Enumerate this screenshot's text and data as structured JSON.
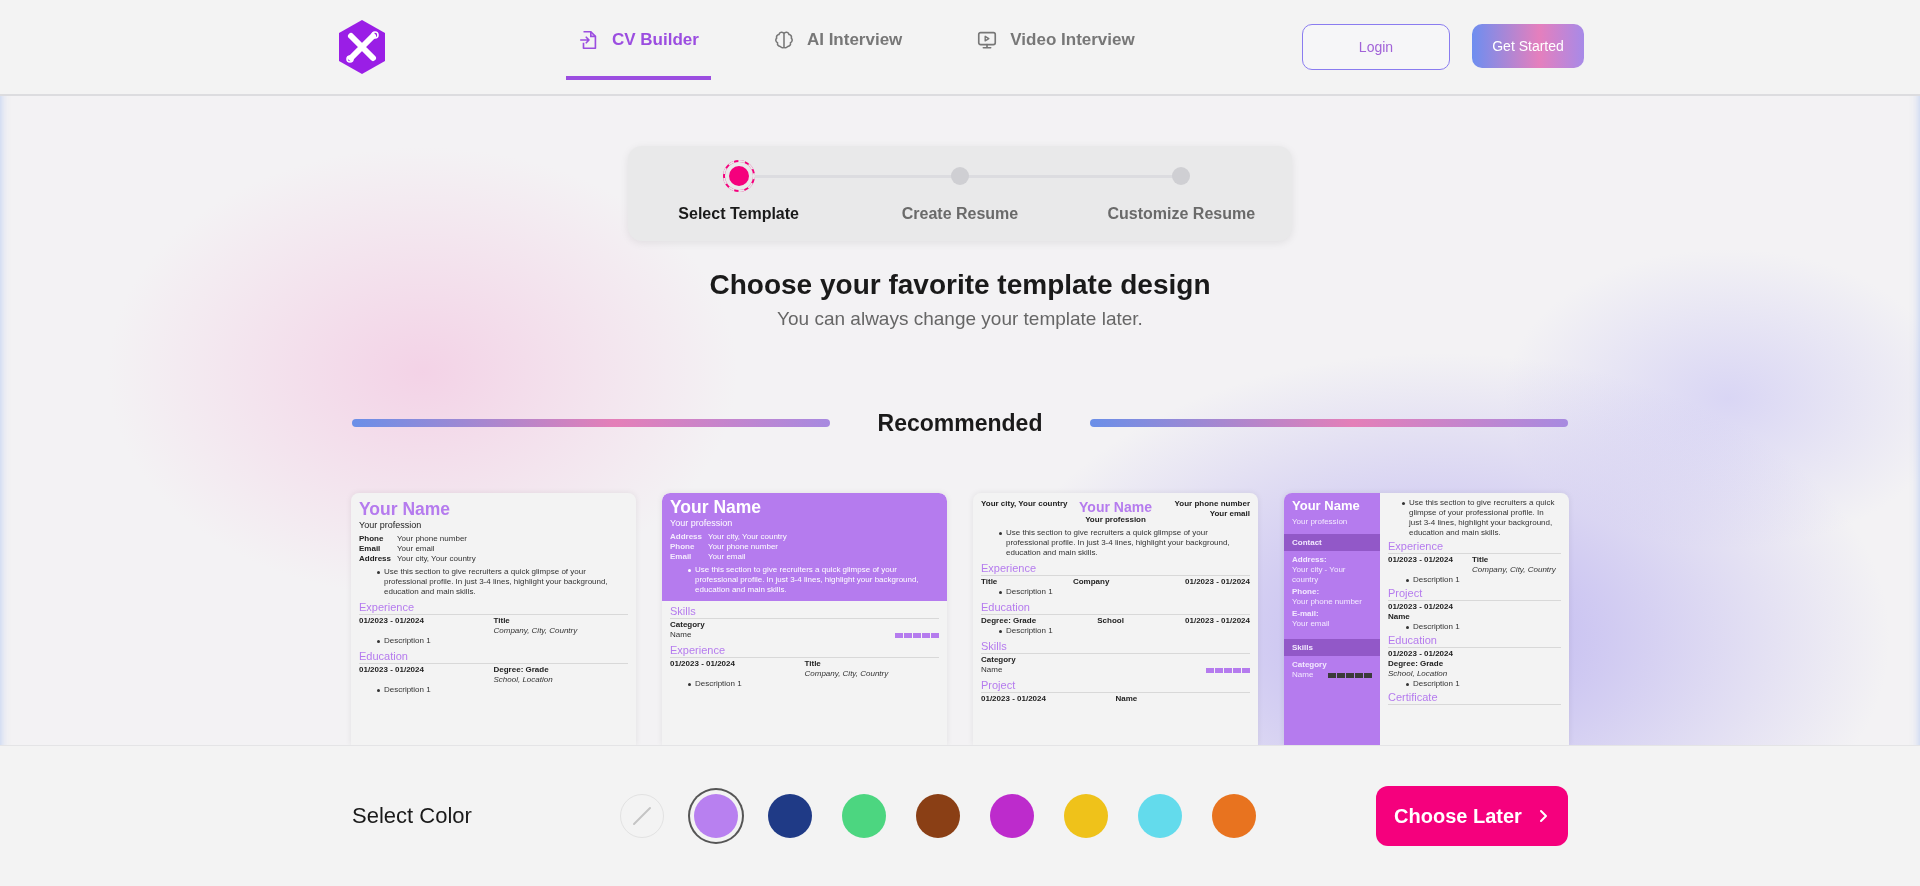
{
  "nav": {
    "tabs": [
      {
        "label": "CV Builder",
        "selected": true
      },
      {
        "label": "AI Interview",
        "selected": false
      },
      {
        "label": "Video Interview",
        "selected": false
      }
    ],
    "login": "Login",
    "get_started": "Get Started"
  },
  "steps": [
    {
      "label": "Select Template",
      "selected": true
    },
    {
      "label": "Create Resume",
      "selected": false
    },
    {
      "label": "Customize Resume",
      "selected": false
    }
  ],
  "heading": "Choose your favorite template design",
  "subheading": "You can always change your template later.",
  "section_label": "Recommended",
  "cards": [
    {
      "kind": "classic",
      "name": "Your Name",
      "profession": "Your profession",
      "contacts": [
        {
          "label": "Phone",
          "value": "Your phone number"
        },
        {
          "label": "Email",
          "value": "Your email"
        },
        {
          "label": "Address",
          "value": "Your city, Your country"
        }
      ],
      "summary": "Use this section to give recruiters a quick glimpse of your professional profile. In just 3-4 lines, highlight your background, education and main skills.",
      "sections": [
        {
          "title": "Experience",
          "entries": [
            {
              "kind": "row",
              "date": "01/2023 - 01/2024",
              "title": "Title",
              "detail": "Company, City, Country",
              "bullets": [
                "Description 1"
              ]
            }
          ]
        },
        {
          "title": "Education",
          "entries": [
            {
              "kind": "row",
              "date": "01/2023 - 01/2024",
              "title": "Degree: Grade",
              "detail": "School, Location",
              "bullets": [
                "Description 1"
              ]
            }
          ]
        }
      ]
    },
    {
      "kind": "banner",
      "name": "Your Name",
      "profession": "Your profession",
      "contacts": [
        {
          "label": "Address",
          "value": "Your city, Your country"
        },
        {
          "label": "Phone",
          "value": "Your phone number"
        },
        {
          "label": "Email",
          "value": "Your email"
        }
      ],
      "summary": "Use this section to give recruiters a quick glimpse of your professional profile. In just 3-4 lines, highlight your background, education and main skills.",
      "sections": [
        {
          "title": "Skills",
          "entries": [
            {
              "kind": "skill",
              "category": "Category",
              "name": "Name",
              "stars": 5
            }
          ]
        },
        {
          "title": "Experience",
          "entries": [
            {
              "kind": "row",
              "date": "01/2023 - 01/2024",
              "title": "Title",
              "detail": "Company, City, Country",
              "bullets": [
                "Description 1"
              ]
            }
          ]
        }
      ]
    },
    {
      "kind": "centered",
      "name": "Your Name",
      "profession": "Your profession",
      "contacts": [
        {
          "value": "Your city, Your country"
        },
        {
          "value": "Your phone number"
        },
        {
          "value": "Your email"
        }
      ],
      "summary": "Use this section to give recruiters a quick glimpse of your professional profile. In just 3-4 lines, highlight your background, education and main skills.",
      "sections": [
        {
          "title": "Experience",
          "entries": [
            {
              "kind": "row3",
              "cells": [
                "Title",
                "Company",
                "01/2023 - 01/2024"
              ],
              "bullets": [
                "Description 1"
              ]
            }
          ]
        },
        {
          "title": "Education",
          "entries": [
            {
              "kind": "row3",
              "cells": [
                "Degree: Grade",
                "School",
                "01/2023 - 01/2024"
              ],
              "bullets": [
                "Description 1"
              ]
            }
          ]
        },
        {
          "title": "Skills",
          "entries": [
            {
              "kind": "skill",
              "category": "Category",
              "name": "Name",
              "stars": 5
            }
          ]
        },
        {
          "title": "Project",
          "entries": [
            {
              "kind": "row",
              "date": "01/2023 - 01/2024",
              "title": "Name"
            }
          ]
        }
      ]
    },
    {
      "kind": "sidebar",
      "name": "Your Name",
      "profession": "Your profession",
      "contact_title": "Contact",
      "contacts": [
        {
          "label": "Address:",
          "value": "Your city - Your country"
        },
        {
          "label": "Phone:",
          "value": "Your phone number"
        },
        {
          "label": "E-mail:",
          "value": "Your email"
        }
      ],
      "skills_title": "Skills",
      "skills": [
        {
          "category": "Category",
          "name": "Name",
          "stars": 5
        }
      ],
      "summary": "Use this section to give recruiters a quick glimpse of your professional profile. In just 3-4 lines, highlight your background, education and main skills.",
      "sections": [
        {
          "title": "Experience",
          "entries": [
            {
              "kind": "row",
              "date": "01/2023 - 01/2024",
              "title": "Title",
              "detail": "Company, City, Country",
              "bullets": [
                "Description 1"
              ]
            }
          ]
        },
        {
          "title": "Project",
          "entries": [
            {
              "kind": "stack",
              "date": "01/2023 - 01/2024",
              "title": "Name",
              "bullets": [
                "Description 1"
              ]
            }
          ]
        },
        {
          "title": "Education",
          "entries": [
            {
              "kind": "stack",
              "date": "01/2023 - 01/2024",
              "title": "Degree: Grade",
              "detail": "School, Location",
              "bullets": [
                "Description 1"
              ]
            }
          ]
        },
        {
          "title": "Certificate"
        }
      ]
    }
  ],
  "color_label": "Select Color",
  "swatches": [
    {
      "kind": "none",
      "selected": false
    },
    {
      "kind": "color",
      "color": "#b880f0",
      "selected": true
    },
    {
      "kind": "color",
      "color": "#1f3a86",
      "selected": false
    },
    {
      "kind": "color",
      "color": "#4cd680",
      "selected": false
    },
    {
      "kind": "color",
      "color": "#8a3f15",
      "selected": false
    },
    {
      "kind": "color",
      "color": "#bd2bcc",
      "selected": false
    },
    {
      "kind": "color",
      "color": "#efc21a",
      "selected": false
    },
    {
      "kind": "color",
      "color": "#63dbec",
      "selected": false
    },
    {
      "kind": "color",
      "color": "#e8731f",
      "selected": false
    }
  ],
  "choose_later": "Choose Later"
}
